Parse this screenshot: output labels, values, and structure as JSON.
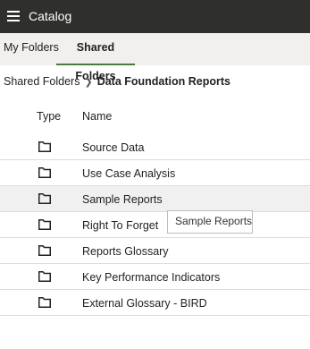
{
  "app": {
    "title": "Catalog"
  },
  "tabs": [
    {
      "label": "My Folders"
    },
    {
      "label": "Shared Folders"
    }
  ],
  "breadcrumb": {
    "parent": "Shared Folders",
    "current": "Data Foundation Reports"
  },
  "table": {
    "headers": {
      "type": "Type",
      "name": "Name"
    },
    "rows": [
      {
        "type": "folder-icon",
        "name": "Source Data"
      },
      {
        "type": "folder-icon",
        "name": "Use Case Analysis"
      },
      {
        "type": "folder-icon",
        "name": "Sample Reports"
      },
      {
        "type": "folder-icon",
        "name": "Right To Forget"
      },
      {
        "type": "folder-icon",
        "name": "Reports Glossary"
      },
      {
        "type": "folder-icon",
        "name": "Key Performance Indicators"
      },
      {
        "type": "folder-icon",
        "name": "External Glossary - BIRD"
      }
    ]
  },
  "tooltip": {
    "text": "Sample Reports"
  },
  "colors": {
    "topbar": "#2f2f2d",
    "tab_underline": "#4a7a3c",
    "row_hover": "#f0f0f0"
  }
}
